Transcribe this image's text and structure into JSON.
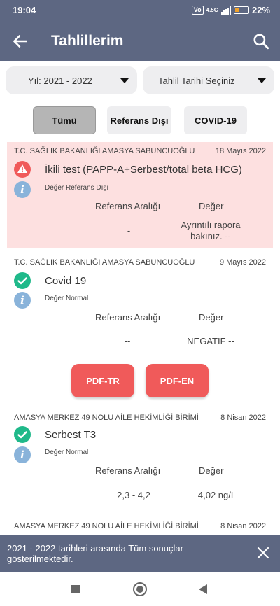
{
  "status_bar": {
    "time": "19:04",
    "volte": "VoLTE",
    "network": "4.5G",
    "battery": "22%"
  },
  "app_bar": {
    "title": "Tahlillerim"
  },
  "filters": {
    "year": "Yıl: 2021 - 2022",
    "date": "Tahlil Tarihi Seçiniz"
  },
  "tabs": [
    "Tümü",
    "Referans Dışı",
    "COVID-19"
  ],
  "results": [
    {
      "institution": "T.C. SAĞLIK BAKANLIĞI AMASYA SABUNCUOĞLU",
      "date": "18 Mayıs 2022",
      "test": "İkili test (PAPP-A+Serbest/total beta HCG)",
      "status": "Değer Referans Dışı",
      "ref_header": "Referans Aralığı",
      "value_header": "Değer",
      "ref_value": "-",
      "value_line1": "Ayrıntılı rapora",
      "value_line2": "bakınız.  --"
    },
    {
      "institution": "T.C. SAĞLIK BAKANLIĞI AMASYA SABUNCUOĞLU",
      "date": "9 Mayıs 2022",
      "test": "Covid 19",
      "status": "Değer Normal",
      "ref_header": "Referans Aralığı",
      "value_header": "Değer",
      "ref_value": "--",
      "value": "NEGATIF --",
      "pdf_buttons": [
        "PDF-TR",
        "PDF-EN"
      ]
    },
    {
      "institution": "AMASYA MERKEZ 49 NOLU AİLE HEKİMLİĞİ BİRİMİ",
      "date": "8 Nisan 2022",
      "test": "Serbest T3",
      "status": "Değer Normal",
      "ref_header": "Referans Aralığı",
      "value_header": "Değer",
      "ref_value": "2,3 - 4,2",
      "value": "4,02 ng/L"
    },
    {
      "institution": "AMASYA MERKEZ 49 NOLU AİLE HEKİMLİĞİ BİRİMİ",
      "date": "8 Nisan 2022"
    }
  ],
  "snackbar": {
    "message": "2021 - 2022 tarihleri arasında Tüm sonuçlar gösterilmektedir."
  },
  "colors": {
    "primary": "#5d6782",
    "alert_bg": "#fde0e0",
    "alert": "#f05a5a",
    "ok": "#1fb98a",
    "info": "#89b3da"
  }
}
